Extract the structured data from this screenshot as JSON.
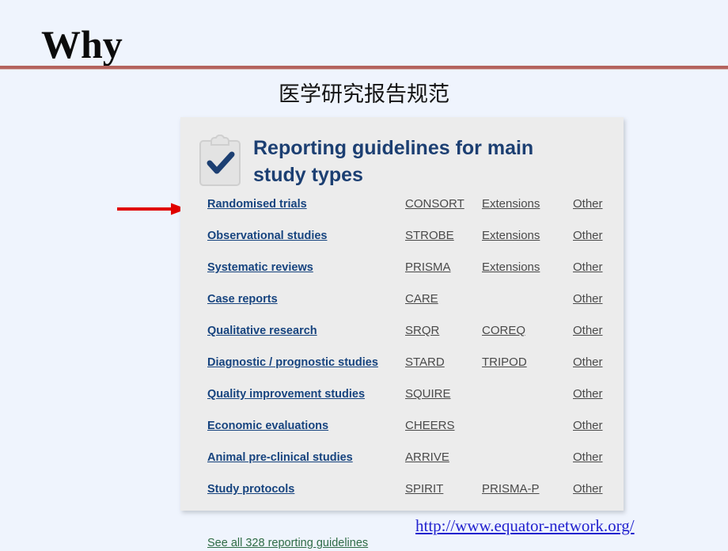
{
  "slide": {
    "title": "Why",
    "subtitle": "医学研究报告规范",
    "rule_color": "#b4635e",
    "background_color": "#eff4fd"
  },
  "card": {
    "heading": "Reporting guidelines for main study types",
    "heading_color": "#1c3f72",
    "background_color": "#ececec",
    "icon": "clipboard-check-icon",
    "footer": {
      "label": "See all 328 reporting guidelines",
      "count": "328",
      "color": "#2e6b45"
    },
    "rows": [
      {
        "type": "Randomised trials",
        "a": "CONSORT",
        "b": "Extensions",
        "c": "Other"
      },
      {
        "type": "Observational studies",
        "a": "STROBE",
        "b": "Extensions",
        "c": "Other"
      },
      {
        "type": "Systematic reviews",
        "a": "PRISMA",
        "b": "Extensions",
        "c": "Other"
      },
      {
        "type": "Case reports",
        "a": "CARE",
        "b": "",
        "c": "Other"
      },
      {
        "type": "Qualitative research",
        "a": "SRQR",
        "b": "COREQ",
        "c": "Other"
      },
      {
        "type": "Diagnostic / prognostic studies",
        "a": "STARD",
        "b": "TRIPOD",
        "c": "Other"
      },
      {
        "type": "Quality improvement studies",
        "a": "SQUIRE",
        "b": "",
        "c": "Other"
      },
      {
        "type": "Economic evaluations",
        "a": "CHEERS",
        "b": "",
        "c": "Other"
      },
      {
        "type": "Animal pre-clinical studies",
        "a": "ARRIVE",
        "b": "",
        "c": "Other"
      },
      {
        "type": "Study protocols",
        "a": "SPIRIT",
        "b": "PRISMA-P",
        "c": "Other"
      }
    ]
  },
  "annotation": {
    "arrow": "red-arrow-pointing-to-randomised-trials",
    "arrow_color": "#e00000"
  },
  "source": {
    "url": "http://www.equator-network.org/",
    "color": "#2121cf"
  }
}
